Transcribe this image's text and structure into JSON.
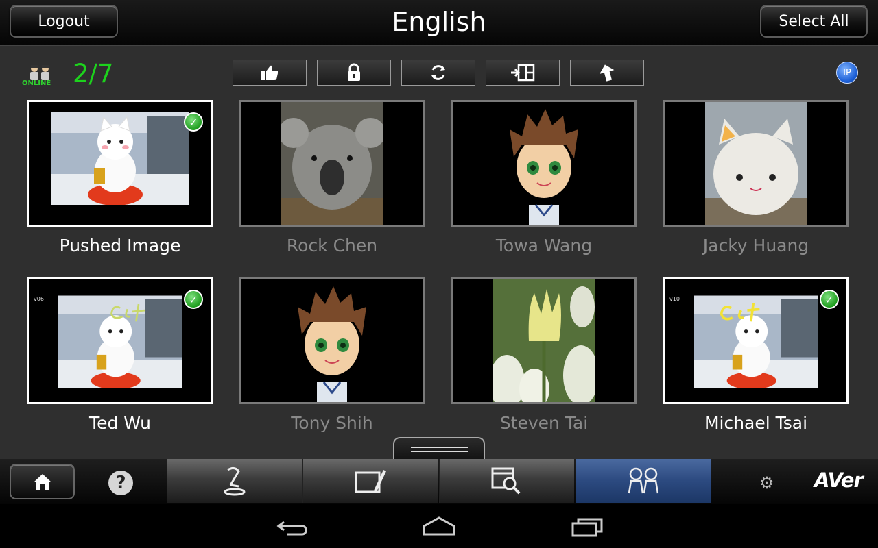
{
  "header": {
    "title": "English",
    "logout_label": "Logout",
    "select_all_label": "Select All"
  },
  "status": {
    "online_label": "ONLINE",
    "count": "2/7",
    "ip_label": "IP"
  },
  "toolbar": {
    "buttons": [
      "thumbs-up-icon",
      "lock-icon",
      "refresh-icon",
      "split-view-icon",
      "upload-arrow-icon"
    ]
  },
  "tiles": [
    {
      "name": "Pushed Image",
      "active": true,
      "checked": true,
      "version": "",
      "content": "lucky cat photo"
    },
    {
      "name": "Rock Chen",
      "active": false,
      "checked": false,
      "version": "",
      "content": "koala photo"
    },
    {
      "name": "Towa Wang",
      "active": false,
      "checked": false,
      "version": "",
      "content": "cartoon boy avatar"
    },
    {
      "name": "Jacky Huang",
      "active": false,
      "checked": false,
      "version": "",
      "content": "white cat plush photo"
    },
    {
      "name": "Ted Wu",
      "active": true,
      "checked": true,
      "version": "v06",
      "content": "lucky cat photo with annotation"
    },
    {
      "name": "Tony Shih",
      "active": false,
      "checked": false,
      "version": "",
      "content": "cartoon boy avatar"
    },
    {
      "name": "Steven Tai",
      "active": false,
      "checked": false,
      "version": "",
      "content": "tulip photo"
    },
    {
      "name": "Michael Tsai",
      "active": true,
      "checked": true,
      "version": "v10",
      "content": "lucky cat photo with annotation"
    }
  ],
  "bottom": {
    "help_label": "?",
    "logo": "AVer",
    "tabs": [
      "document-camera-icon",
      "annotation-icon",
      "browser-search-icon",
      "students-icon"
    ],
    "selected_tab": "students-icon"
  },
  "colors": {
    "online_green": "#1dd21d",
    "selected_tab": "#2c4a80",
    "active_border": "#ffffff",
    "idle_border": "#7a7a7a"
  }
}
